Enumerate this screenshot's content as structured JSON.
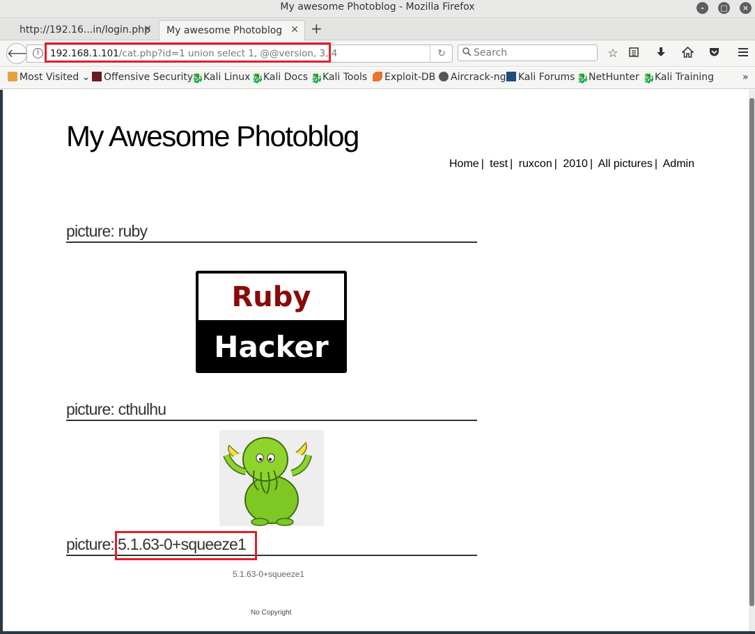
{
  "window": {
    "title": "My awesome Photoblog - Mozilla Firefox"
  },
  "tabs": [
    {
      "label": "http://192.16...in/login.php"
    },
    {
      "label": "My awesome Photoblog"
    }
  ],
  "urlbar": {
    "host": "192.168.1.101",
    "path": "/cat.php?id=1 union select 1, @@version, 3, 4"
  },
  "search": {
    "placeholder": "Search"
  },
  "bookmarks": [
    "Most Visited",
    "Offensive Security",
    "Kali Linux",
    "Kali Docs",
    "Kali Tools",
    "Exploit-DB",
    "Aircrack-ng",
    "Kali Forums",
    "NetHunter",
    "Kali Training"
  ],
  "site": {
    "title": "My Awesome Photoblog",
    "nav": [
      "Home",
      "test",
      "ruxcon",
      "2010",
      "All pictures",
      "Admin"
    ],
    "pictures": [
      {
        "heading": "picture: ruby",
        "image_text_top": "Ruby",
        "image_text_bottom": "Hacker"
      },
      {
        "heading": "picture: cthulhu"
      },
      {
        "heading_prefix": "picture:",
        "heading_value": "5.1.63-0+squeeze1",
        "caption": "5.1.63-0+squeeze1"
      }
    ],
    "footer": "No Copyright"
  }
}
